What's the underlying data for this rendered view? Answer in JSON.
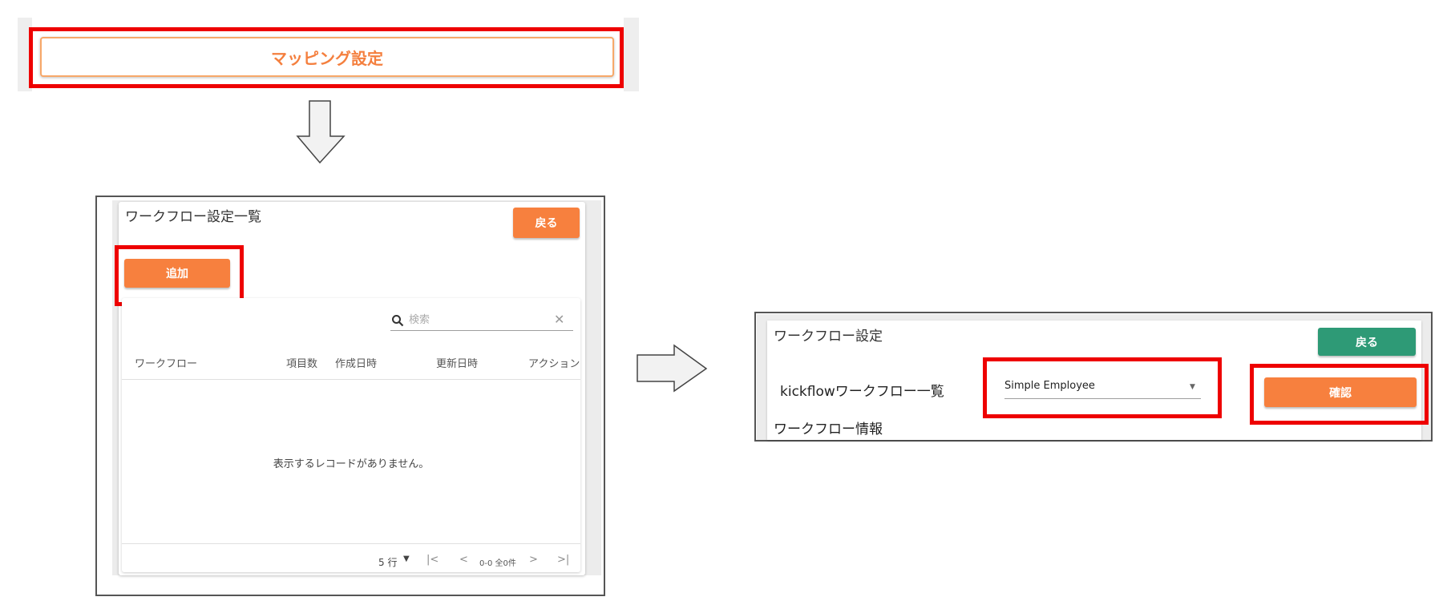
{
  "top": {
    "mapping_button_label": "マッピング設定"
  },
  "left_panel": {
    "title": "ワークフロー設定一覧",
    "back_label": "戻る",
    "add_label": "追加",
    "search": {
      "placeholder": "検索"
    },
    "table": {
      "columns": [
        "ワークフロー",
        "項目数",
        "作成日時",
        "更新日時",
        "アクション"
      ],
      "empty_message": "表示するレコードがありません。"
    },
    "pagination": {
      "rows_per_page": "5 行",
      "range_text": "0-0 全0件"
    }
  },
  "right_panel": {
    "title": "ワークフロー設定",
    "back_label": "戻る",
    "workflow_list_label": "kickflowワークフロー一覧",
    "selected_workflow": "Simple Employee",
    "confirm_label": "確認",
    "info_label": "ワークフロー情報"
  },
  "colors": {
    "accent_orange": "#f7803e",
    "back_green": "#2e9a76",
    "highlight_red": "#ee0000"
  },
  "icons": [
    "search-icon",
    "clear-icon",
    "dropdown-caret-icon",
    "first-page-icon",
    "prev-page-icon",
    "next-page-icon",
    "last-page-icon",
    "down-arrow-icon",
    "right-arrow-icon"
  ]
}
